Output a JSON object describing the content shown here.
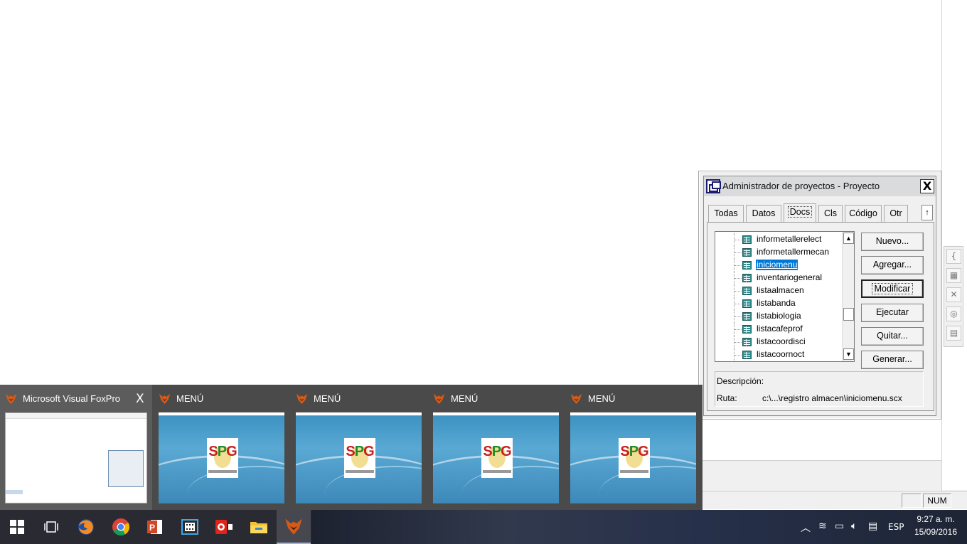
{
  "project_manager": {
    "title": "Administrador de proyectos - Proyecto",
    "close": "X",
    "tabs": [
      "Todas",
      "Datos",
      "Docs",
      "Cls",
      "Código",
      "Otr"
    ],
    "active_tab": "Docs",
    "tab_scroll": "↑",
    "tree_items": [
      "informetallerelect",
      "informetallermecan",
      "iniciomenu",
      "inventariogeneral",
      "listaalmacen",
      "listabanda",
      "listabiologia",
      "listacafeprof",
      "listacoordisci",
      "listacoornoct"
    ],
    "selected_item": "iniciomenu",
    "buttons": {
      "nuevo": "Nuevo...",
      "agregar": "Agregar...",
      "modificar": "Modificar",
      "ejecutar": "Ejecutar",
      "quitar": "Quitar...",
      "generar": "Generar..."
    },
    "descripcion_label": "Descripción:",
    "ruta_label": "Ruta:",
    "ruta_value": "c:\\...\\registro almacen\\iniciomenu.scx"
  },
  "statusbar": {
    "num": "NUM"
  },
  "previews": [
    {
      "title": "Microsoft Visual FoxPro",
      "close": "X",
      "kind": "vfp"
    },
    {
      "title": "MENÚ",
      "kind": "desktop"
    },
    {
      "title": "MENÚ",
      "kind": "desktop"
    },
    {
      "title": "MENÚ",
      "kind": "desktop"
    },
    {
      "title": "MENÚ",
      "kind": "desktop"
    }
  ],
  "thumbnail_logo": {
    "s": "S",
    "p": "P",
    "g": "G"
  },
  "taskbar": {
    "apps": [
      "start-icon",
      "task-view-icon",
      "firefox-icon",
      "chrome-icon",
      "powerpoint-icon",
      "video-editor-icon",
      "media-player-icon",
      "file-explorer-icon",
      "foxpro-icon"
    ],
    "language": "ESP",
    "time": "9:27 a. m.",
    "date": "15/09/2016"
  },
  "colors": {
    "selection": "#0078d7",
    "taskbar": "#2a2a33",
    "preview_bg": "#4a4a4a"
  }
}
